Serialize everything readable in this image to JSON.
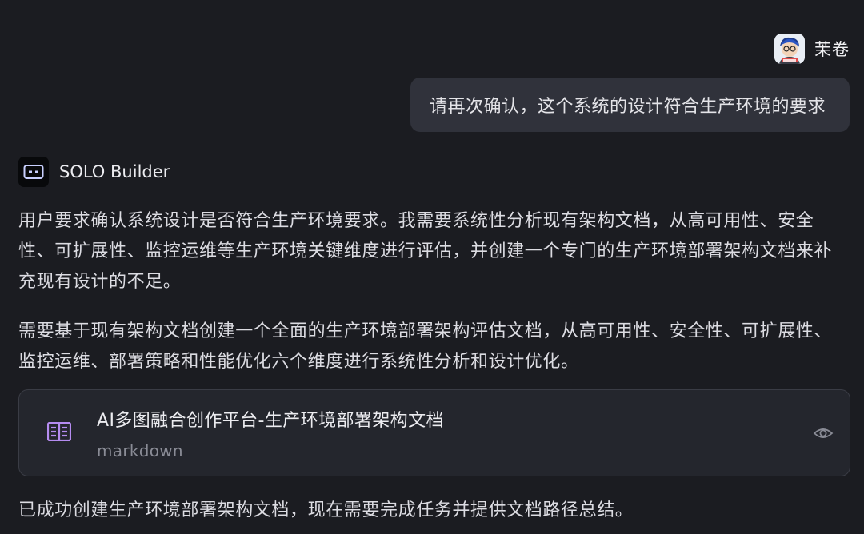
{
  "user": {
    "name": "茉卷",
    "message": "请再次确认，这个系统的设计符合生产环境的要求"
  },
  "assistant": {
    "name": "SOLO Builder",
    "paragraph_1": "用户要求确认系统设计是否符合生产环境要求。我需要系统性分析现有架构文档，从高可用性、安全性、可扩展性、监控运维等生产环境关键维度进行评估，并创建一个专门的生产环境部署架构文档来补充现有设计的不足。",
    "paragraph_2": "需要基于现有架构文档创建一个全面的生产环境部署架构评估文档，从高可用性、安全性、可扩展性、监控运维、部署策略和性能优化六个维度进行系统性分析和设计优化。",
    "file_card": {
      "title": "AI多图融合创作平台-生产环境部署架构文档",
      "type": "markdown",
      "icon": "document-icon",
      "action_icon": "eye-icon"
    },
    "paragraph_3": "已成功创建生产环境部署架构文档，现在需要完成任务并提供文档路径总结。"
  },
  "colors": {
    "background": "#1b1c21",
    "user_bubble": "#30323b",
    "card": "#24262d",
    "doc_icon": "#b58cf0"
  }
}
